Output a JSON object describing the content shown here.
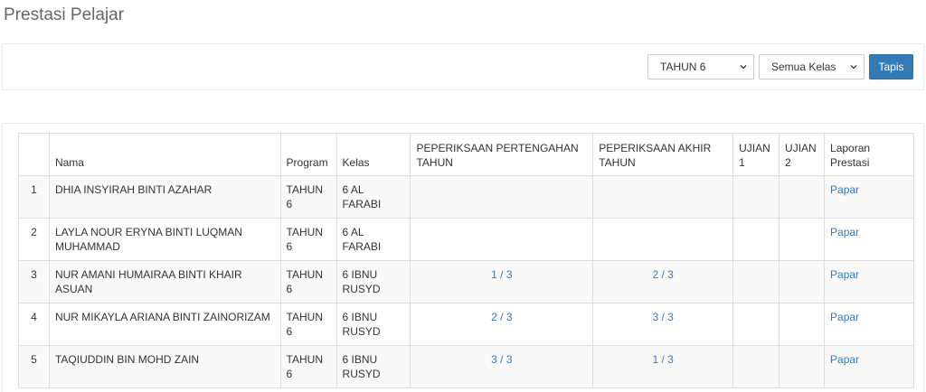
{
  "page": {
    "title": "Prestasi Pelajar"
  },
  "filters": {
    "year_select": {
      "value": "TAHUN 6"
    },
    "class_select": {
      "value": "Semua Kelas"
    },
    "filter_button": "Tapis"
  },
  "table": {
    "headers": {
      "no": "",
      "nama": "Nama",
      "program": "Program",
      "kelas": "Kelas",
      "pertengahan": "PEPERIKSAAN PERTENGAHAN TAHUN",
      "akhir": "PEPERIKSAAN AKHIR TAHUN",
      "ujian1": "UJIAN 1",
      "ujian2": "UJIAN 2",
      "laporan": "Laporan Prestasi"
    },
    "rows": [
      {
        "no": "1",
        "nama": "DHIA INSYIRAH BINTI AZAHAR",
        "program": "TAHUN 6",
        "kelas": "6 AL FARABI",
        "pertengahan": "",
        "akhir": "",
        "ujian1": "",
        "ujian2": "",
        "laporan": "Papar"
      },
      {
        "no": "2",
        "nama": "LAYLA NOUR ERYNA BINTI LUQMAN MUHAMMAD",
        "program": "TAHUN 6",
        "kelas": "6 AL FARABI",
        "pertengahan": "",
        "akhir": "",
        "ujian1": "",
        "ujian2": "",
        "laporan": "Papar"
      },
      {
        "no": "3",
        "nama": "NUR AMANI HUMAIRAA BINTI KHAIR ASUAN",
        "program": "TAHUN 6",
        "kelas": "6 IBNU RUSYD",
        "pertengahan": "1 / 3",
        "akhir": "2 / 3",
        "ujian1": "",
        "ujian2": "",
        "laporan": "Papar"
      },
      {
        "no": "4",
        "nama": "NUR MIKAYLA ARIANA BINTI ZAINORIZAM",
        "program": "TAHUN 6",
        "kelas": "6 IBNU RUSYD",
        "pertengahan": "2 / 3",
        "akhir": "3 / 3",
        "ujian1": "",
        "ujian2": "",
        "laporan": "Papar"
      },
      {
        "no": "5",
        "nama": "TAQIUDDIN BIN MOHD ZAIN",
        "program": "TAHUN 6",
        "kelas": "6 IBNU RUSYD",
        "pertengahan": "3 / 3",
        "akhir": "1 / 3",
        "ujian1": "",
        "ujian2": "",
        "laporan": "Papar"
      }
    ]
  },
  "icons": {
    "select_caret": "chevron-down-icon"
  },
  "colors": {
    "primary": "#337ab7",
    "border": "#dddddd",
    "stripe": "#f9f9f9"
  }
}
